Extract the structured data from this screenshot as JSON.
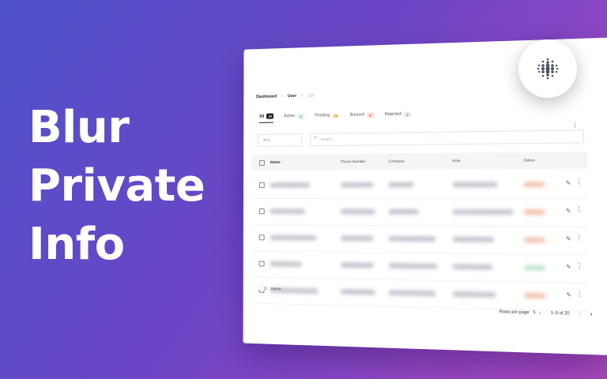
{
  "hero": {
    "line1": "Blur",
    "line2": "Private",
    "line3": "Info"
  },
  "breadcrumb": {
    "home": "Dashboard",
    "section": "User",
    "current": "List"
  },
  "tabs": [
    {
      "label": "All",
      "count": "20",
      "badge": "b-all"
    },
    {
      "label": "Active",
      "count": "2",
      "badge": "b-active"
    },
    {
      "label": "Pending",
      "count": "10",
      "badge": "b-pending"
    },
    {
      "label": "Banned",
      "count": "6",
      "badge": "b-banned"
    },
    {
      "label": "Rejected",
      "count": "2",
      "badge": "b-rejected"
    }
  ],
  "filters": {
    "role_placeholder": "Role",
    "search_placeholder": "Search..."
  },
  "table": {
    "columns": {
      "name": "Name",
      "phone": "Phone Number",
      "company": "Company",
      "role": "Role",
      "status": "Status"
    }
  },
  "dense_label": "Dense",
  "pagination": {
    "rows_per_page_label": "Rows per page:",
    "rows_per_page_value": "5",
    "range": "1–5 of 20"
  },
  "icons": {
    "logo": "dot-grid-logo-icon",
    "edit": "pencil-icon",
    "more": "kebab-menu-icon",
    "search": "search-icon"
  }
}
